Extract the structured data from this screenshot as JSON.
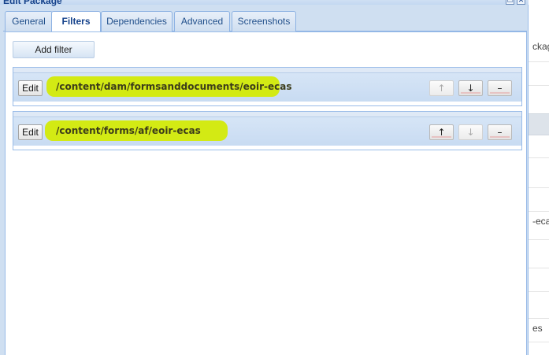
{
  "dialog": {
    "title": "Edit Package",
    "tool_minimize_glyph": "▭",
    "tool_close_glyph": "✕"
  },
  "tabs": [
    {
      "label": "General",
      "active": false
    },
    {
      "label": "Filters",
      "active": true
    },
    {
      "label": "Dependencies",
      "active": false
    },
    {
      "label": "Advanced",
      "active": false
    },
    {
      "label": "Screenshots",
      "active": false
    }
  ],
  "toolbar": {
    "add_filter_label": "Add filter"
  },
  "filters": [
    {
      "edit_label": "Edit",
      "path": "/content/dam/formsanddocuments/eoir-ecas",
      "highlighted": true,
      "up": {
        "glyph": "↑",
        "enabled": false
      },
      "down": {
        "glyph": "↓",
        "enabled": true
      },
      "remove": {
        "glyph": "–",
        "enabled": true
      }
    },
    {
      "edit_label": "Edit",
      "path": "/content/forms/af/eoir-ecas",
      "highlighted": true,
      "up": {
        "glyph": "↑",
        "enabled": true
      },
      "down": {
        "glyph": "↓",
        "enabled": false
      },
      "remove": {
        "glyph": "–",
        "enabled": true
      }
    }
  ],
  "background": {
    "row_texts": [
      "ckag",
      "-eca",
      "es"
    ]
  },
  "colors": {
    "highlight": "#d3ea07",
    "accent": "#15428b",
    "border": "#99bbe8"
  }
}
